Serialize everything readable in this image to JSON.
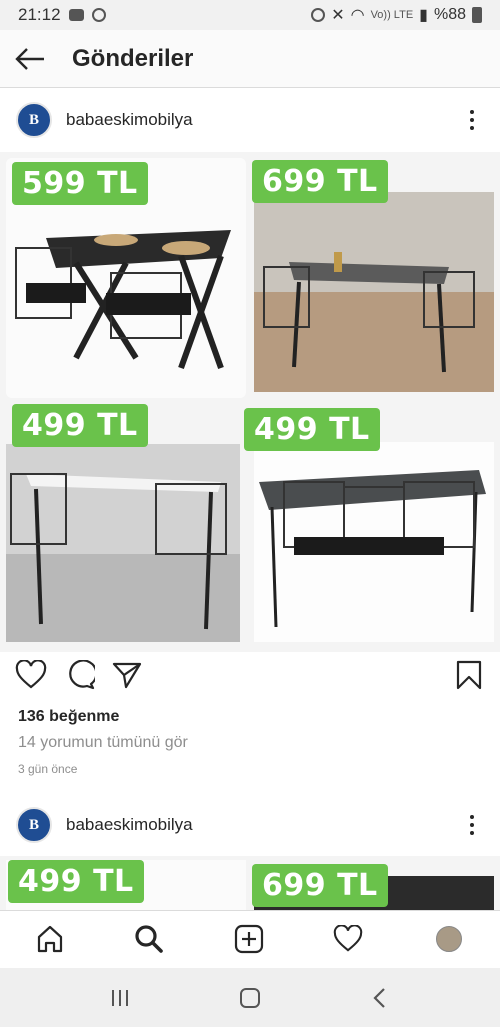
{
  "status_bar": {
    "time": "21:12",
    "battery": "%88",
    "network_label": "Vo)) LTE"
  },
  "header": {
    "title": "Gönderiler"
  },
  "post1": {
    "username": "babaeskimobilya",
    "avatar_letter": "B",
    "prices": [
      "599 TL",
      "699 TL",
      "499 TL",
      "499 TL"
    ],
    "likes": "136 beğenme",
    "comments_link": "14 yorumun tümünü gör",
    "time_ago": "3 gün önce"
  },
  "post2": {
    "username": "babaeskimobilya",
    "avatar_letter": "B",
    "prices": [
      "499 TL",
      "699 TL"
    ]
  },
  "colors": {
    "price_tag": "#6ac24b",
    "brand_avatar": "#1f4d93"
  },
  "icons": {
    "nav": [
      "home-icon",
      "search-icon",
      "add-post-icon",
      "activity-heart-icon",
      "profile-avatar"
    ],
    "actions": [
      "like-heart-icon",
      "comment-icon",
      "share-icon",
      "bookmark-icon"
    ]
  }
}
